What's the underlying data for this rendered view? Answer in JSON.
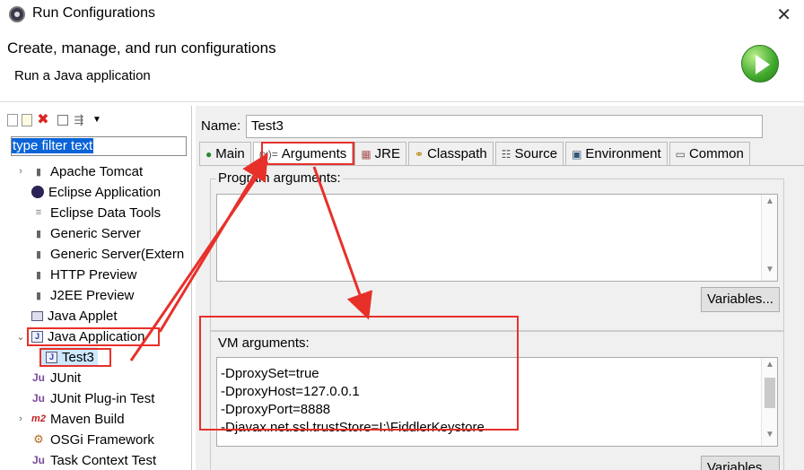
{
  "window": {
    "title": "Run Configurations"
  },
  "header": {
    "title": "Create, manage, and run configurations",
    "subtitle": "Run a Java application"
  },
  "sidebar": {
    "filter_text": "type filter text",
    "items": [
      {
        "label": "Apache Tomcat",
        "icon": "tomcat-icon",
        "expand": "›"
      },
      {
        "label": "Eclipse Application",
        "icon": "eclipse-icon",
        "expand": ""
      },
      {
        "label": "Eclipse Data Tools",
        "icon": "database-icon",
        "expand": ""
      },
      {
        "label": "Generic Server",
        "icon": "server-icon",
        "expand": ""
      },
      {
        "label": "Generic Server(Extern",
        "icon": "server-icon",
        "expand": ""
      },
      {
        "label": "HTTP Preview",
        "icon": "server-icon",
        "expand": ""
      },
      {
        "label": "J2EE Preview",
        "icon": "server-icon",
        "expand": ""
      },
      {
        "label": "Java Applet",
        "icon": "applet-icon",
        "expand": ""
      },
      {
        "label": "Java Application",
        "icon": "java-app-icon",
        "expand": "⌄"
      },
      {
        "label": "Test3",
        "icon": "java-app-icon",
        "expand": ""
      },
      {
        "label": "JUnit",
        "icon": "junit-icon",
        "expand": ""
      },
      {
        "label": "JUnit Plug-in Test",
        "icon": "junit-plugin-icon",
        "expand": ""
      },
      {
        "label": "Maven Build",
        "icon": "maven-icon",
        "expand": "›"
      },
      {
        "label": "OSGi Framework",
        "icon": "osgi-icon",
        "expand": ""
      },
      {
        "label": "Task Context Test",
        "icon": "task-icon",
        "expand": ""
      }
    ]
  },
  "main": {
    "name_label": "Name:",
    "name_value": "Test3",
    "tabs": [
      {
        "label": "Main",
        "icon": "main-icon"
      },
      {
        "label": "Arguments",
        "icon": "arguments-icon"
      },
      {
        "label": "JRE",
        "icon": "jre-icon"
      },
      {
        "label": "Classpath",
        "icon": "classpath-icon"
      },
      {
        "label": "Source",
        "icon": "source-icon"
      },
      {
        "label": "Environment",
        "icon": "environment-icon"
      },
      {
        "label": "Common",
        "icon": "common-icon"
      }
    ],
    "program_args_label": "Program arguments:",
    "program_args_value": "",
    "vm_args_label": "VM arguments:",
    "vm_args_lines": [
      "-DproxySet=true",
      "-DproxyHost=127.0.0.1",
      "-DproxyPort=8888",
      "-Djavax.net.ssl.trustStore=I:\\FiddlerKeystore"
    ],
    "variables_label": "Variables..."
  },
  "colors": {
    "highlight": "#e8302a",
    "selection": "#0a64d8",
    "tree_selected": "#cde8ff"
  }
}
